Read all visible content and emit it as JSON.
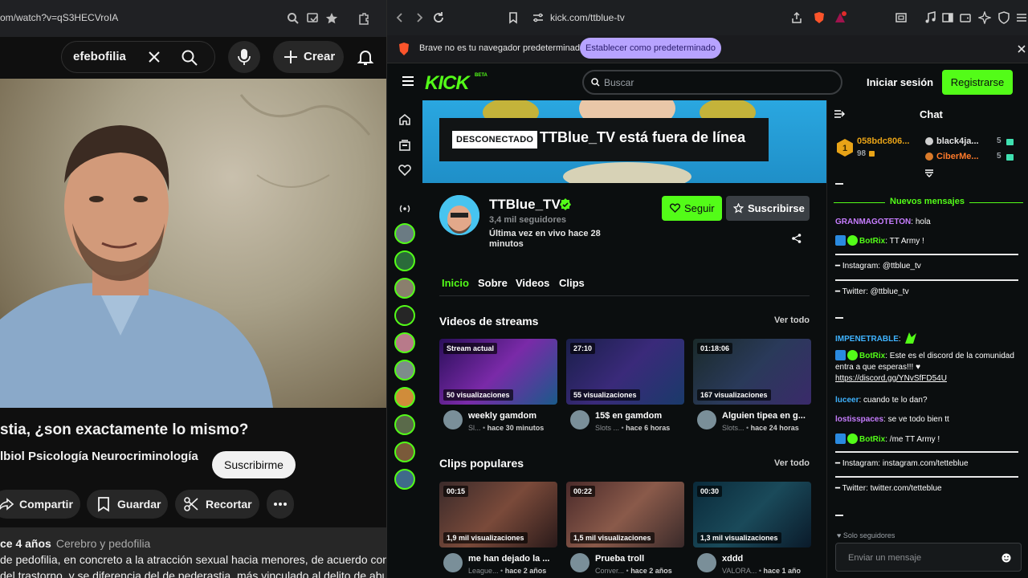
{
  "youtube": {
    "url": "om/watch?v=qS3HECVroIA",
    "search_value": "efebofilia",
    "create_label": "Crear",
    "title": "stia, ¿son exactamente lo mismo?",
    "channel": "lbiol Psicología Neurocriminología",
    "subscribe_label": "Suscribirme",
    "actions": {
      "share": "Compartir",
      "save": "Guardar",
      "clip": "Recortar"
    },
    "description": {
      "age": "ce 4 años",
      "tags": "Cerebro y pedofilia",
      "line1": "de pedofilia, en concreto a la atracción sexual hacia menores, de acuerdo con las",
      "line2": "del trastorno, y se diferencia del de pederastia, más vinculado al delito de abuso"
    }
  },
  "browser": {
    "url": "kick.com/ttblue-tv",
    "notice": "Brave no es tu navegador predeterminado",
    "set_default_label": "Establecer como predeterminado"
  },
  "kick": {
    "logo": "KICK",
    "logo_badge": "BETA",
    "search_placeholder": "Buscar",
    "login_label": "Iniciar sesión",
    "register_label": "Registrarse",
    "offline_badge": "DESCONECTADO",
    "offline_text": "TTBlue_TV está fuera de línea",
    "channel_name": "TTBlue_TV",
    "followers": "3,4 mil seguidores",
    "last_live": "Última vez en vivo hace 28 minutos",
    "follow_label": "Seguir",
    "subscribe_label": "Suscribirse",
    "tabs": [
      "Inicio",
      "Sobre",
      "Videos",
      "Clips"
    ],
    "streams_section": {
      "title": "Videos de streams",
      "see_all": "Ver todo"
    },
    "clips_section": {
      "title": "Clips populares",
      "see_all": "Ver todo"
    },
    "stream_videos": [
      {
        "badge": "Stream actual",
        "views": "50 visualizaciones",
        "title": "weekly gamdom",
        "category": "Sl...",
        "time": "hace 30 minutos"
      },
      {
        "badge": "27:10",
        "views": "55 visualizaciones",
        "title": "15$ en gamdom",
        "category": "Slots ...",
        "time": "hace 6 horas"
      },
      {
        "badge": "01:18:06",
        "views": "167 visualizaciones",
        "title": "Alguien tipea en g...",
        "category": "Slots...",
        "time": "hace 24 horas"
      }
    ],
    "clips": [
      {
        "badge": "00:15",
        "views": "1,9 mil visualizaciones",
        "title": "me han dejado la ...",
        "category": "League...",
        "time": "hace 2 años"
      },
      {
        "badge": "00:22",
        "views": "1,5 mil visualizaciones",
        "title": "Prueba troll",
        "category": "Conver...",
        "time": "hace 2 años"
      },
      {
        "badge": "00:30",
        "views": "1,3 mil visualizaciones",
        "title": "xddd",
        "category": "VALORA...",
        "time": "hace 1 año"
      }
    ],
    "chat": {
      "title": "Chat",
      "pinned": [
        {
          "user": "058bdc806...",
          "count": "98"
        },
        {
          "user": "black4ja...",
          "count": "5"
        },
        {
          "user": "CiberMe...",
          "count": "5"
        }
      ],
      "new_messages": "Nuevos mensajes",
      "messages": [
        {
          "user": "GRANMAGOTETON",
          "text": " hola",
          "color": "#c77dff"
        },
        {
          "user": "BotRix",
          "text": " TT Army !",
          "color": "#53fc18"
        },
        {
          "user": "",
          "text": "Instagram: @ttblue_tv",
          "color": "#ffffff"
        },
        {
          "user": "",
          "text": "Twitter: @ttblue_tv",
          "color": "#ffffff"
        },
        {
          "user": "IMPENETRABLE",
          "text": "",
          "color": "#3fb3ff"
        },
        {
          "user": "BotRix",
          "text": " Este es el discord de la comunidad entra a que esperas!!! ♥",
          "color": "#53fc18"
        },
        {
          "user": "",
          "text": "https://discord.gg/YNvSfFD54U",
          "color": "#ffffff"
        },
        {
          "user": "luceer",
          "text": " cuando te lo dan?",
          "color": "#3fb3ff"
        },
        {
          "user": "lostisspaces",
          "text": " se ve todo bien tt",
          "color": "#c77dff"
        },
        {
          "user": "BotRix",
          "text": " /me TT Army !",
          "color": "#53fc18"
        },
        {
          "user": "",
          "text": "Instagram: instagram.com/tetteblue",
          "color": "#ffffff"
        },
        {
          "user": "",
          "text": "Twitter: twitter.com/tetteblue",
          "color": "#ffffff"
        }
      ],
      "followers_only": "Solo seguidores",
      "input_placeholder": "Enviar un mensaje"
    }
  }
}
